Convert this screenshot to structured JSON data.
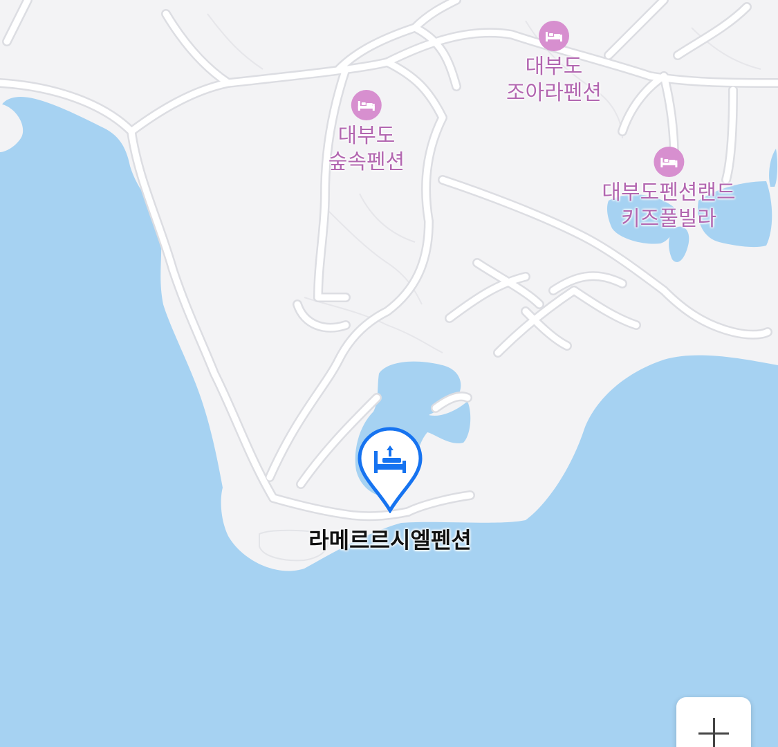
{
  "map": {
    "colors": {
      "water": "#a6d2f2",
      "land": "#f3f3f5",
      "road": "#ffffff",
      "road_casing": "#dedfe3",
      "poi_icon": "#d78fcf",
      "poi_label": "#b266b0",
      "selected_marker": "#1673f0"
    },
    "pois": [
      {
        "icon": "bed-icon",
        "line1": "대부도",
        "line2": "조아라펜션"
      },
      {
        "icon": "bed-icon",
        "line1": "대부도",
        "line2": "숲속펜션"
      },
      {
        "icon": "bed-icon",
        "line1": "대부도펜션랜드",
        "line2": "키즈풀빌라"
      }
    ],
    "selected": {
      "icon": "bed-icon",
      "label": "라메르르시엘펜션"
    }
  },
  "controls": {
    "zoom_in_icon": "plus-icon"
  }
}
